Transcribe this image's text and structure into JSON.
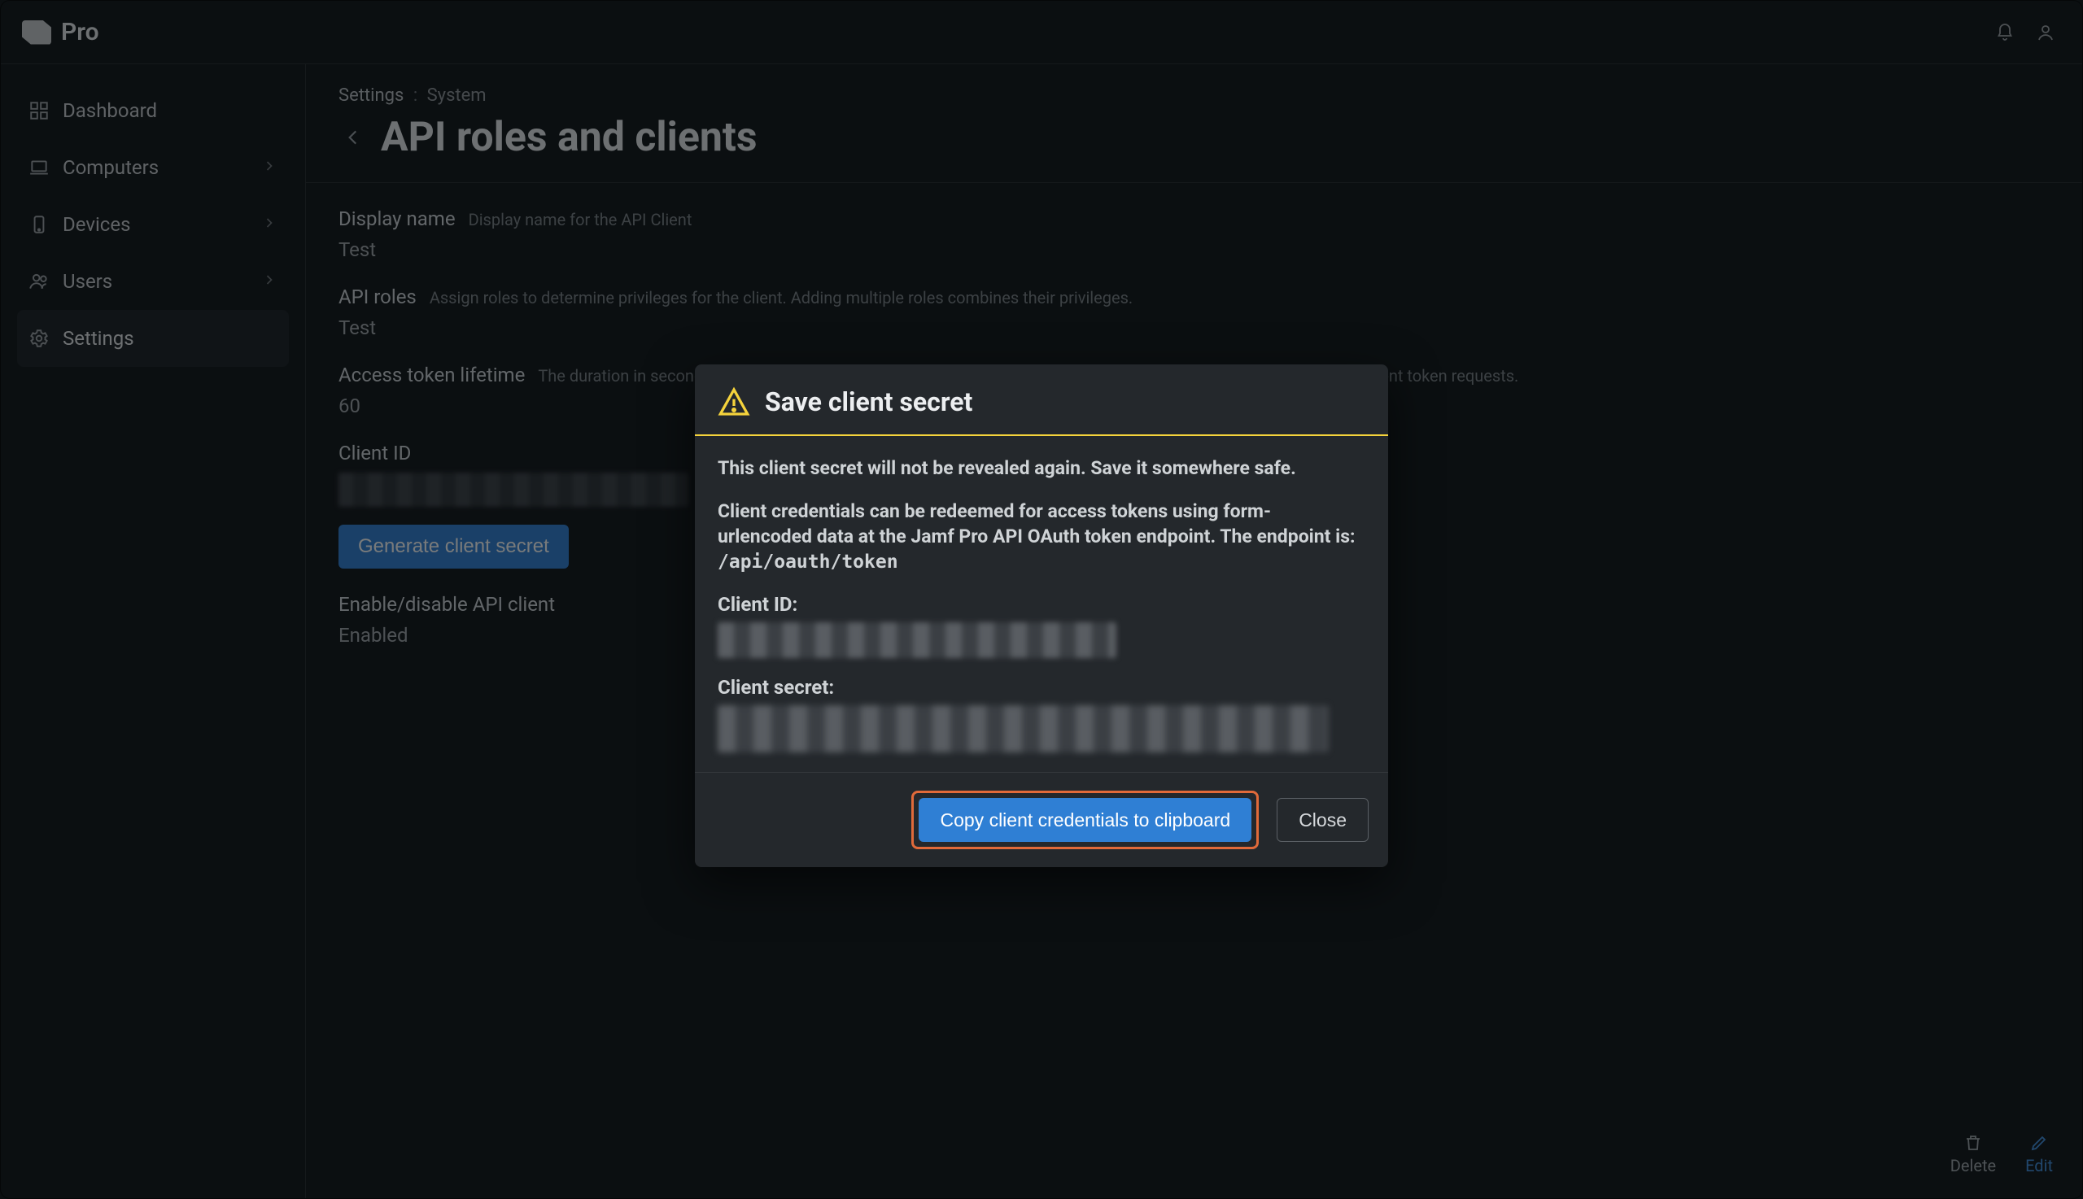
{
  "brand": {
    "name": "Pro"
  },
  "topbar": {
    "notifications_icon": "bell-icon",
    "user_icon": "user-icon"
  },
  "sidebar": {
    "items": [
      {
        "label": "Dashboard",
        "icon": "grid-icon",
        "expandable": false
      },
      {
        "label": "Computers",
        "icon": "laptop-icon",
        "expandable": true
      },
      {
        "label": "Devices",
        "icon": "phone-icon",
        "expandable": true
      },
      {
        "label": "Users",
        "icon": "users-icon",
        "expandable": true
      },
      {
        "label": "Settings",
        "icon": "gear-icon",
        "expandable": false,
        "active": true
      }
    ]
  },
  "breadcrumbs": {
    "root": "Settings",
    "leaf": "System",
    "sep": ":"
  },
  "page": {
    "back_label": "Back",
    "title": "API roles and clients"
  },
  "fields": {
    "display_name": {
      "label": "Display name",
      "help": "Display name for the API Client",
      "value": "Test"
    },
    "api_roles": {
      "label": "API roles",
      "help": "Assign roles to determine privileges for the client. Adding multiple roles combines their privileges.",
      "value": "Test"
    },
    "token_lifetime": {
      "label": "Access token lifetime",
      "help": "The duration in seconds that an access token remains valid. Shorter lifetimes are more secure but require more frequent token requests.",
      "value": "60"
    },
    "client_id": {
      "label": "Client ID"
    },
    "generate_btn": {
      "label": "Generate client secret"
    },
    "enable": {
      "label": "Enable/disable API client",
      "value": "Enabled"
    }
  },
  "footer": {
    "delete": "Delete",
    "edit": "Edit"
  },
  "modal": {
    "title": "Save client secret",
    "warn_line": "This client secret will not be revealed again. Save it somewhere safe.",
    "info_line_pre": "Client credentials can be redeemed for access tokens using form-urlencoded data at the Jamf Pro API OAuth token endpoint. The endpoint is: ",
    "endpoint_code": "/api/oauth/token",
    "client_id_label": "Client ID:",
    "client_secret_label": "Client secret:",
    "copy_button": "Copy client credentials to clipboard",
    "close_button": "Close"
  }
}
